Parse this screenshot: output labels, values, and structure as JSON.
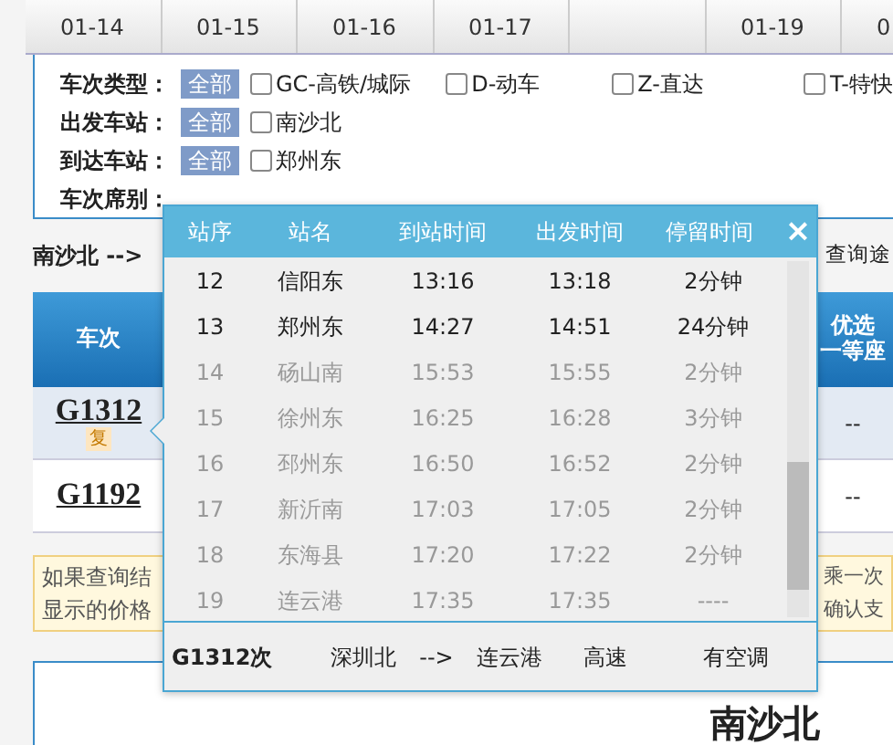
{
  "date_tabs": [
    {
      "kind": "date",
      "label": "01-14"
    },
    {
      "kind": "date",
      "label": "01-15"
    },
    {
      "kind": "date",
      "label": "01-16"
    },
    {
      "kind": "date",
      "label": "01-17"
    },
    {
      "kind": "blank"
    },
    {
      "kind": "date",
      "label": "01-19"
    },
    {
      "kind": "date",
      "label": "0"
    }
  ],
  "filters": [
    {
      "label": "车次类型：",
      "all": "全部",
      "options": [
        {
          "label": "GC-高铁/城际",
          "checked": false
        },
        {
          "label": "D-动车",
          "checked": false
        },
        {
          "label": "Z-直达",
          "checked": false
        },
        {
          "label": "T-特快",
          "checked": false
        }
      ]
    },
    {
      "label": "出发车站：",
      "all": "全部",
      "options": [
        {
          "label": "南沙北",
          "checked": false
        }
      ]
    },
    {
      "label": "到达车站：",
      "all": "全部",
      "options": [
        {
          "label": "郑州东",
          "checked": false
        }
      ]
    },
    {
      "label": "车次席别："
    }
  ],
  "route_heading": "南沙北 -->",
  "route_query_link": "查询途",
  "table": {
    "columns": [
      {
        "lines": [
          "车次"
        ]
      },
      {
        "lines": [
          "优选",
          "一等座"
        ]
      }
    ],
    "rows": [
      {
        "train": "G1312",
        "badge": "复",
        "price": "--",
        "selected": true
      },
      {
        "train": "G1192",
        "price": "--",
        "selected": false
      }
    ]
  },
  "notice": {
    "left_lines": [
      "如果查询结",
      "显示的价格"
    ],
    "right_lines": [
      "乘一次",
      "确认支"
    ]
  },
  "bottom_station": "南沙北",
  "stops_popup": {
    "columns": [
      "站序",
      "站名",
      "到站时间",
      "出发时间",
      "停留时间"
    ],
    "close": "×",
    "stops": [
      {
        "no": "12",
        "station": "信阳东",
        "arrive": "13:16",
        "depart": "13:18",
        "stay": "2分钟",
        "in_route": true
      },
      {
        "no": "13",
        "station": "郑州东",
        "arrive": "14:27",
        "depart": "14:51",
        "stay": "24分钟",
        "in_route": true
      },
      {
        "no": "14",
        "station": "砀山南",
        "arrive": "15:53",
        "depart": "15:55",
        "stay": "2分钟",
        "in_route": false
      },
      {
        "no": "15",
        "station": "徐州东",
        "arrive": "16:25",
        "depart": "16:28",
        "stay": "3分钟",
        "in_route": false
      },
      {
        "no": "16",
        "station": "邳州东",
        "arrive": "16:50",
        "depart": "16:52",
        "stay": "2分钟",
        "in_route": false
      },
      {
        "no": "17",
        "station": "新沂南",
        "arrive": "17:03",
        "depart": "17:05",
        "stay": "2分钟",
        "in_route": false
      },
      {
        "no": "18",
        "station": "东海县",
        "arrive": "17:20",
        "depart": "17:22",
        "stay": "2分钟",
        "in_route": false
      },
      {
        "no": "19",
        "station": "连云港",
        "arrive": "17:35",
        "depart": "17:35",
        "stay": "----",
        "in_route": false
      }
    ],
    "footer": {
      "train": "G1312次",
      "from": "深圳北",
      "arrow": "-->",
      "to": "连云港",
      "type": "高速",
      "aircon": "有空调"
    }
  }
}
